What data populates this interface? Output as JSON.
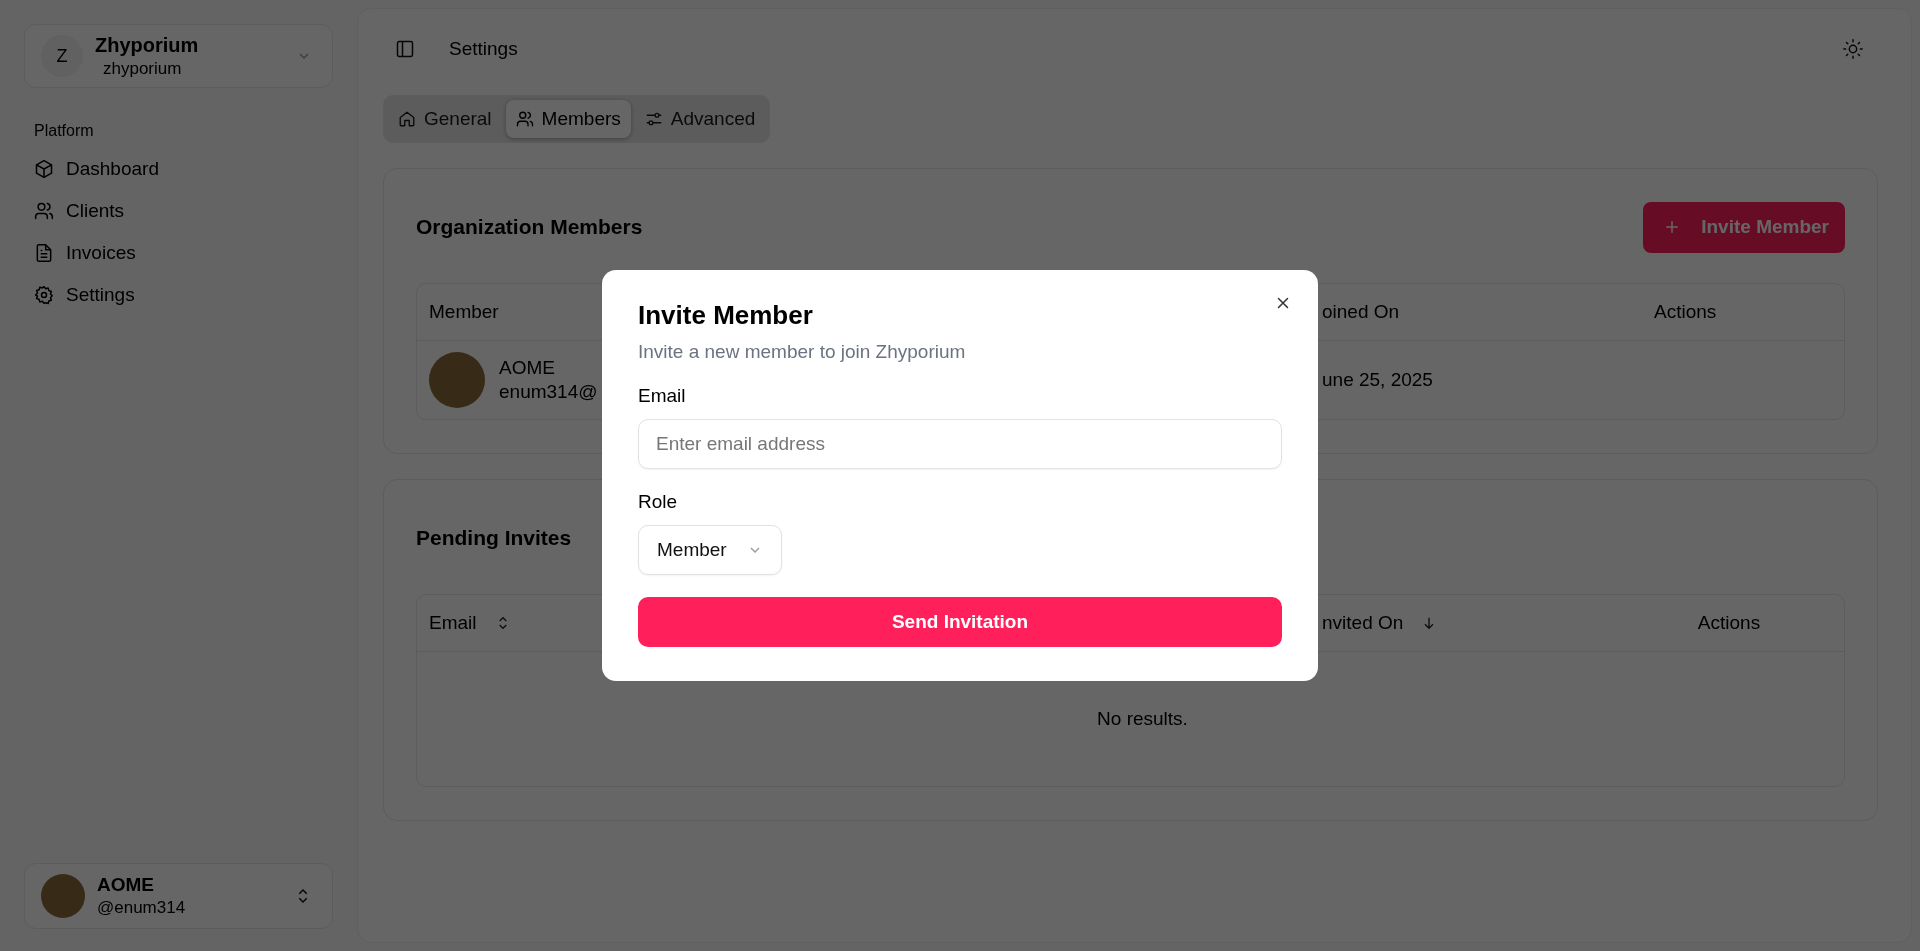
{
  "workspace": {
    "initial": "Z",
    "name": "Zhyporium",
    "slug": "zhyporium"
  },
  "sidebar": {
    "group_label": "Platform",
    "items": [
      {
        "label": "Dashboard",
        "selected": false
      },
      {
        "label": "Clients",
        "selected": false
      },
      {
        "label": "Invoices",
        "selected": false
      },
      {
        "label": "Settings",
        "selected": false
      }
    ]
  },
  "user": {
    "name": "AOME",
    "handle": "@enum314"
  },
  "header": {
    "title": "Settings"
  },
  "tabs": [
    {
      "label": "General",
      "selected": false
    },
    {
      "label": "Members",
      "selected": true
    },
    {
      "label": "Advanced",
      "selected": false
    }
  ],
  "members_card": {
    "title": "Organization Members",
    "invite_button": "Invite Member",
    "columns": [
      "Member",
      "oined On",
      "Actions"
    ],
    "rows": [
      {
        "name": "AOME",
        "email": "enum314@",
        "joined": "une 25, 2025"
      }
    ]
  },
  "pending_card": {
    "title": "Pending Invites",
    "columns": [
      {
        "label": "Email",
        "kind": "sortable"
      },
      {
        "label": "nvited On",
        "kind": "sorted"
      },
      {
        "label": "Actions",
        "kind": "plain"
      }
    ],
    "empty_text": "No results."
  },
  "dialog": {
    "title": "Invite Member",
    "description": "Invite a new member to join Zhyporium",
    "email_label": "Email",
    "email_placeholder": "Enter email address",
    "role_label": "Role",
    "role_value": "Member",
    "submit": "Send Invitation"
  }
}
